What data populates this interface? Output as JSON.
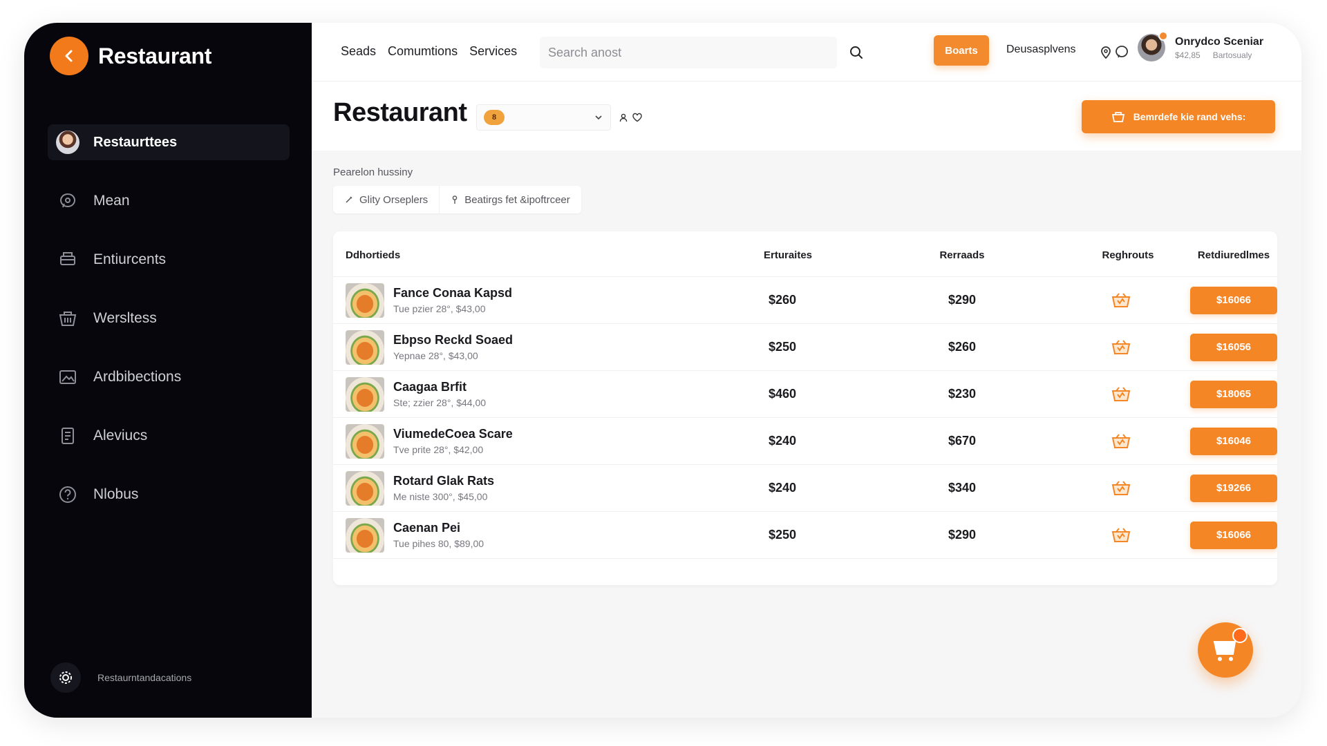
{
  "colors": {
    "accent": "#f48626",
    "sidebar_bg": "#06060c",
    "page_bg": "#f6f6f7"
  },
  "sidebar": {
    "brand": "Restaurant",
    "items": [
      {
        "label": "Restaurttees",
        "icon": "avatar-icon",
        "active": true
      },
      {
        "label": "Mean",
        "icon": "chat-icon"
      },
      {
        "label": "Entiurcents",
        "icon": "printer-icon"
      },
      {
        "label": "Wersltess",
        "icon": "basket-icon"
      },
      {
        "label": "Ardbibections",
        "icon": "image-frame-icon"
      },
      {
        "label": "Aleviucs",
        "icon": "document-icon"
      },
      {
        "label": "Nlobus",
        "icon": "help-icon"
      }
    ],
    "footer_label": "Restaurntandacations"
  },
  "topbar": {
    "nav": [
      "Seads",
      "Comumtions",
      "Services"
    ],
    "search_placeholder": "Search anost",
    "button_label": "Boarts",
    "link": "Deusasplvens",
    "user": {
      "name": "Onrydco Sceniar",
      "sub_left": "$42,85",
      "sub_right": "Bartosualy"
    }
  },
  "header": {
    "title": "Restaurant",
    "select_badge": "8",
    "cta_label": "Bemrdefe kie rand vehs:"
  },
  "filters": {
    "label": "Pearelon hussiny",
    "chips": [
      "Glity Orseplers",
      "Beatirgs fet &ipoftrceer"
    ]
  },
  "table": {
    "columns": [
      "Ddhortieds",
      "Erturaites",
      "Rerraads",
      "Reghrouts",
      "Retdiuredlmes"
    ],
    "rows": [
      {
        "name": "Fance Conaa Kapsd",
        "sub": "Tue pzier 28°,  $43,00",
        "price1": "$260",
        "price2": "$290",
        "action": "$16066"
      },
      {
        "name": "Ebpso Reckd Soaed",
        "sub": "Yepnae 28°,  $43,00",
        "price1": "$250",
        "price2": "$260",
        "action": "$16056"
      },
      {
        "name": "Caagaa Brfit",
        "sub": "Ste; zzier 28°,  $44,00",
        "price1": "$460",
        "price2": "$230",
        "action": "$18065"
      },
      {
        "name": "ViumedeCoea Scare",
        "sub": "Tve prite 28°,  $42,00",
        "price1": "$240",
        "price2": "$670",
        "action": "$16046"
      },
      {
        "name": "Rotard Glak Rats",
        "sub": "Me niste 300°,  $45,00",
        "price1": "$240",
        "price2": "$340",
        "action": "$19266"
      },
      {
        "name": "Caenan Pei",
        "sub": "Tue pihes 80,  $89,00",
        "price1": "$250",
        "price2": "$290",
        "action": "$16066"
      }
    ]
  }
}
